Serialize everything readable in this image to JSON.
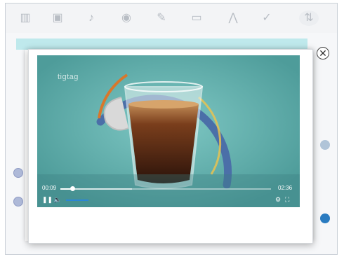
{
  "toolbar": {
    "icons": [
      "grid-icon",
      "image-icon",
      "audio-icon",
      "video-icon",
      "pen-icon",
      "text-box-icon",
      "mountain-icon",
      "check-icon",
      "sort-icon"
    ]
  },
  "video": {
    "logo_text": "tigtag",
    "current_time": "00:09",
    "duration": "02:36",
    "progress_fraction": 0.058,
    "buffered_fraction": 0.34,
    "volume_fraction": 0.8
  },
  "modal": {
    "close_symbol": "✕"
  },
  "colors": {
    "video_bg": "#5fb0ae",
    "accent_blue": "#2a86d6",
    "arc_blue": "#4b6fa8",
    "arc_orange": "#d8772c"
  }
}
